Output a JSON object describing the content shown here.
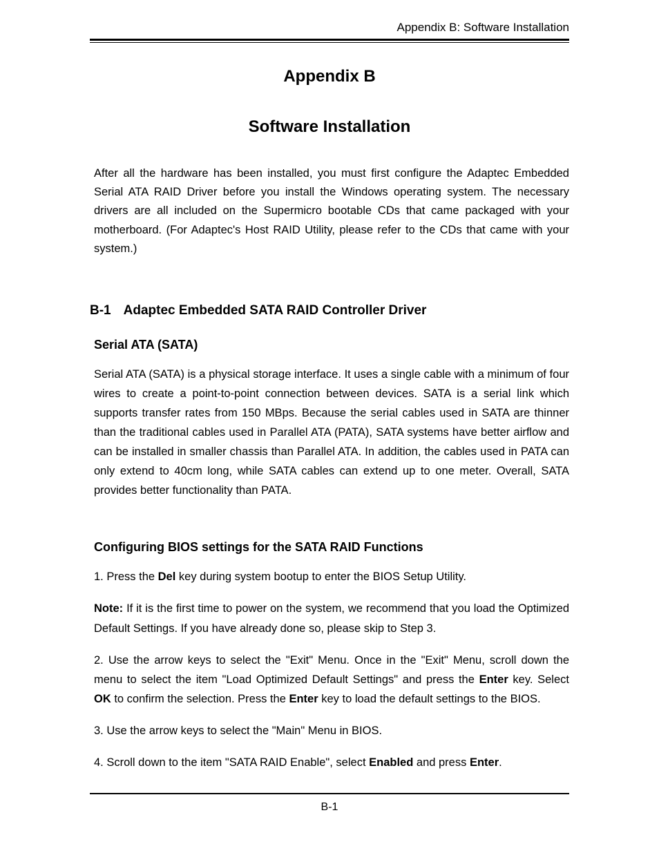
{
  "header": {
    "running_title": "Appendix B: Software Installation"
  },
  "title": {
    "appendix_label": "Appendix B",
    "appendix_title": "Software Installation"
  },
  "intro": "After all the hardware has been installed, you must first configure the Adaptec Embedded Serial ATA RAID Driver before you install the Windows operating system.  The necessary drivers are all included on the Supermicro bootable CDs that came packaged with your motherboard.  (For Adaptec's Host RAID Utility, please refer to the CDs that came with your system.)",
  "section_b1": {
    "number": "B-1",
    "heading": "Adaptec Embedded SATA RAID Controller Driver",
    "sub1_heading": "Serial ATA (SATA)",
    "sub1_body": "Serial ATA (SATA) is a physical storage interface.  It uses a single cable with a minimum of four wires to create a point-to-point connection between devices. SATA is a serial link which supports transfer rates from 150 MBps. Because the serial cables used in  SATA are thinner than the traditional cables used in Parallel ATA (PATA), SATA systems have better airflow and can be installed in smaller chassis than Parallel ATA. In addition, the cables used in PATA can only extend to 40cm long, while SATA cables can extend up to one meter. Overall, SATA provides better functionality than PATA.",
    "sub2_heading": "Configuring BIOS settings for the SATA RAID Functions",
    "step1_pre": "1. Press the ",
    "step1_bold": "Del",
    "step1_post": " key during system bootup to enter the BIOS Setup Utility.",
    "note_label": "Note:",
    "note_body": " If it is the first time to power on the system, we recommend that you load the Optimized Default Settings. If you have already done so, please skip to Step 3.",
    "step2_pre": "2. Use the arrow keys to select the \"Exit\" Menu. Once in the \"Exit\" Menu, scroll down the menu to select the item \"Load Optimized Default Settings\" and press the ",
    "step2_bold1": "Enter",
    "step2_mid1": " key.  Select ",
    "step2_bold2": "OK",
    "step2_mid2": " to confirm the selection.  Press the ",
    "step2_bold3": "Enter",
    "step2_post": " key to load the default settings to the BIOS.",
    "step3": "3. Use the arrow keys to select the \"Main\" Menu in BIOS.",
    "step4_pre": "4. Scroll down to the item \"SATA RAID Enable\", select ",
    "step4_bold1": "Enabled",
    "step4_mid": " and press ",
    "step4_bold2": "Enter",
    "step4_post": "."
  },
  "footer": {
    "page_number": "B-1"
  }
}
